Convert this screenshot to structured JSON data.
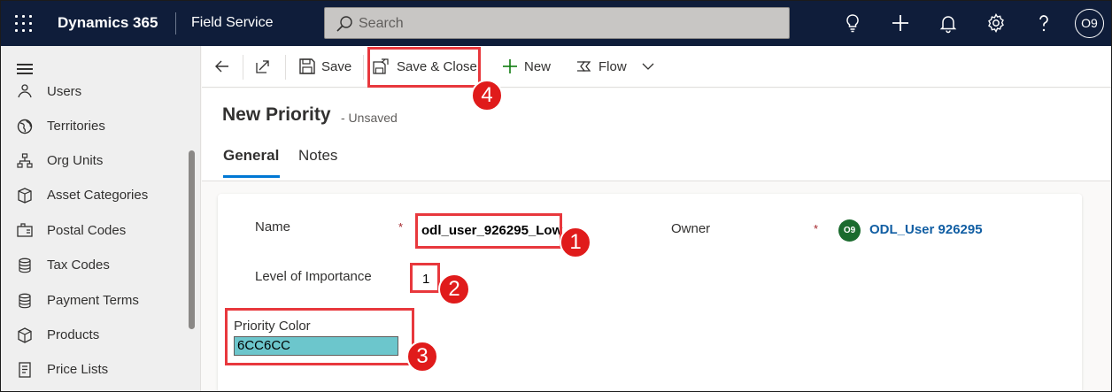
{
  "topbar": {
    "app_name": "Dynamics 365",
    "module_name": "Field Service",
    "search_placeholder": "Search",
    "avatar_initials": "O9",
    "icons": [
      "waffle-icon",
      "search-icon",
      "lightbulb-icon",
      "plus-icon",
      "bell-icon",
      "gear-icon",
      "help-icon"
    ]
  },
  "sidebar": {
    "items": [
      {
        "label": "Users",
        "icon": "users-icon"
      },
      {
        "label": "Territories",
        "icon": "globe-icon"
      },
      {
        "label": "Org Units",
        "icon": "org-units-icon"
      },
      {
        "label": "Asset Categories",
        "icon": "asset-categories-icon"
      },
      {
        "label": "Postal Codes",
        "icon": "postal-codes-icon"
      },
      {
        "label": "Tax Codes",
        "icon": "tax-codes-icon"
      },
      {
        "label": "Payment Terms",
        "icon": "payment-terms-icon"
      },
      {
        "label": "Products",
        "icon": "products-icon"
      },
      {
        "label": "Price Lists",
        "icon": "price-lists-icon"
      }
    ]
  },
  "commandbar": {
    "save_label": "Save",
    "save_close_label": "Save & Close",
    "new_label": "New",
    "flow_label": "Flow"
  },
  "header": {
    "title": "New Priority",
    "status": "- Unsaved",
    "tabs": [
      {
        "label": "General",
        "selected": true
      },
      {
        "label": "Notes",
        "selected": false
      }
    ]
  },
  "form": {
    "name_label": "Name",
    "name_value": "odl_user_926295_Low",
    "required_marker": "*",
    "level_label": "Level of Importance",
    "level_value": "1",
    "owner_label": "Owner",
    "owner_initials": "O9",
    "owner_value": "ODL_User 926295",
    "priority_color_label": "Priority Color",
    "priority_color_value": "6CC6CC"
  },
  "annotations": [
    {
      "number": "1",
      "target": "name-field"
    },
    {
      "number": "2",
      "target": "level-of-importance-field"
    },
    {
      "number": "3",
      "target": "priority-color-field"
    },
    {
      "number": "4",
      "target": "save-close-button"
    }
  ],
  "colors": {
    "topbar": "#0f1d3a",
    "accent": "#0078d4",
    "annotation": "#e8383d",
    "priority_swatch": "#6CC6CC",
    "owner_avatar": "#1b6b2e"
  }
}
